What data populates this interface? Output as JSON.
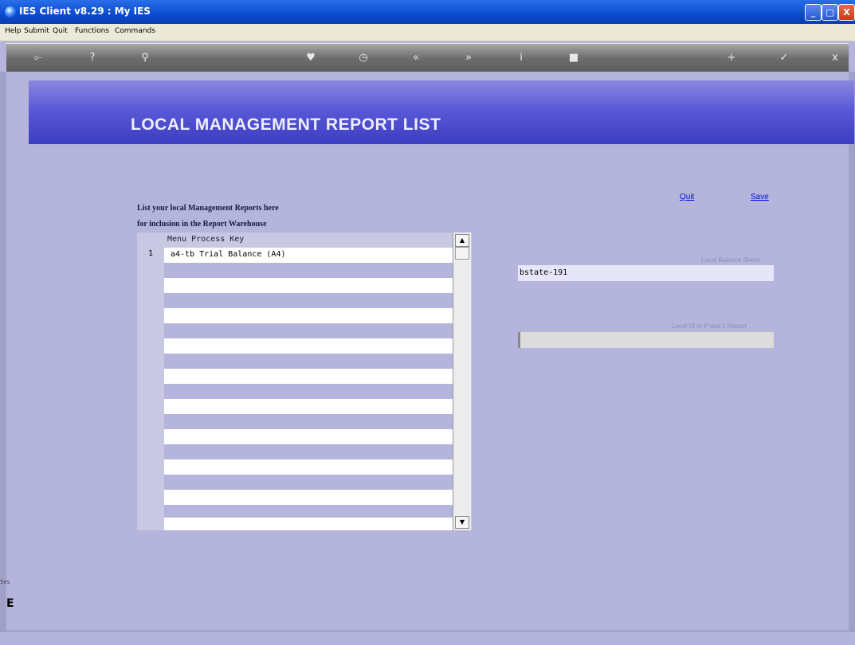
{
  "window": {
    "title": "IES Client v8.29 : My IES",
    "controls": {
      "minimize": "_",
      "maximize": "□",
      "close": "X"
    }
  },
  "menubar": {
    "items": [
      "Help",
      "Submit",
      "Quit",
      "Functions",
      "Commands"
    ]
  },
  "toolbar": {
    "icons": [
      "key-icon",
      "help-icon",
      "search-icon",
      "heart-icon",
      "clock-icon",
      "back-icon",
      "forward-icon",
      "info-icon",
      "stop-icon",
      "add-icon",
      "check-icon",
      "close-icon"
    ],
    "glyphs": [
      "⟜",
      "?",
      "⚲",
      "♥",
      "◷",
      "«",
      "»",
      "i",
      "■",
      "+",
      "✓",
      "x"
    ]
  },
  "banner": {
    "title": "LOCAL MANAGEMENT REPORT LIST"
  },
  "actions": {
    "quit": "Quit",
    "save": "Save"
  },
  "description": {
    "line1": "List your local Management Reports here",
    "line2": "for inclusion in the Report Warehouse"
  },
  "grid": {
    "header": "Menu Process Key",
    "rows": [
      {
        "num": "1",
        "value": "a4-tb Trial Balance (A4)"
      }
    ],
    "scroll_up": "▲",
    "scroll_down": "▼"
  },
  "fields": {
    "balance_sheet": {
      "label": "Local Balance Sheet",
      "value": "bstate-191"
    },
    "pl_report": {
      "label": "Local IS or P and L Report",
      "value": ""
    }
  },
  "sidebar": {
    "text": "Ses",
    "big": "E"
  },
  "colors": {
    "background": "#b4b4dc",
    "banner": "#5a5ad8",
    "link": "#0010e0"
  }
}
